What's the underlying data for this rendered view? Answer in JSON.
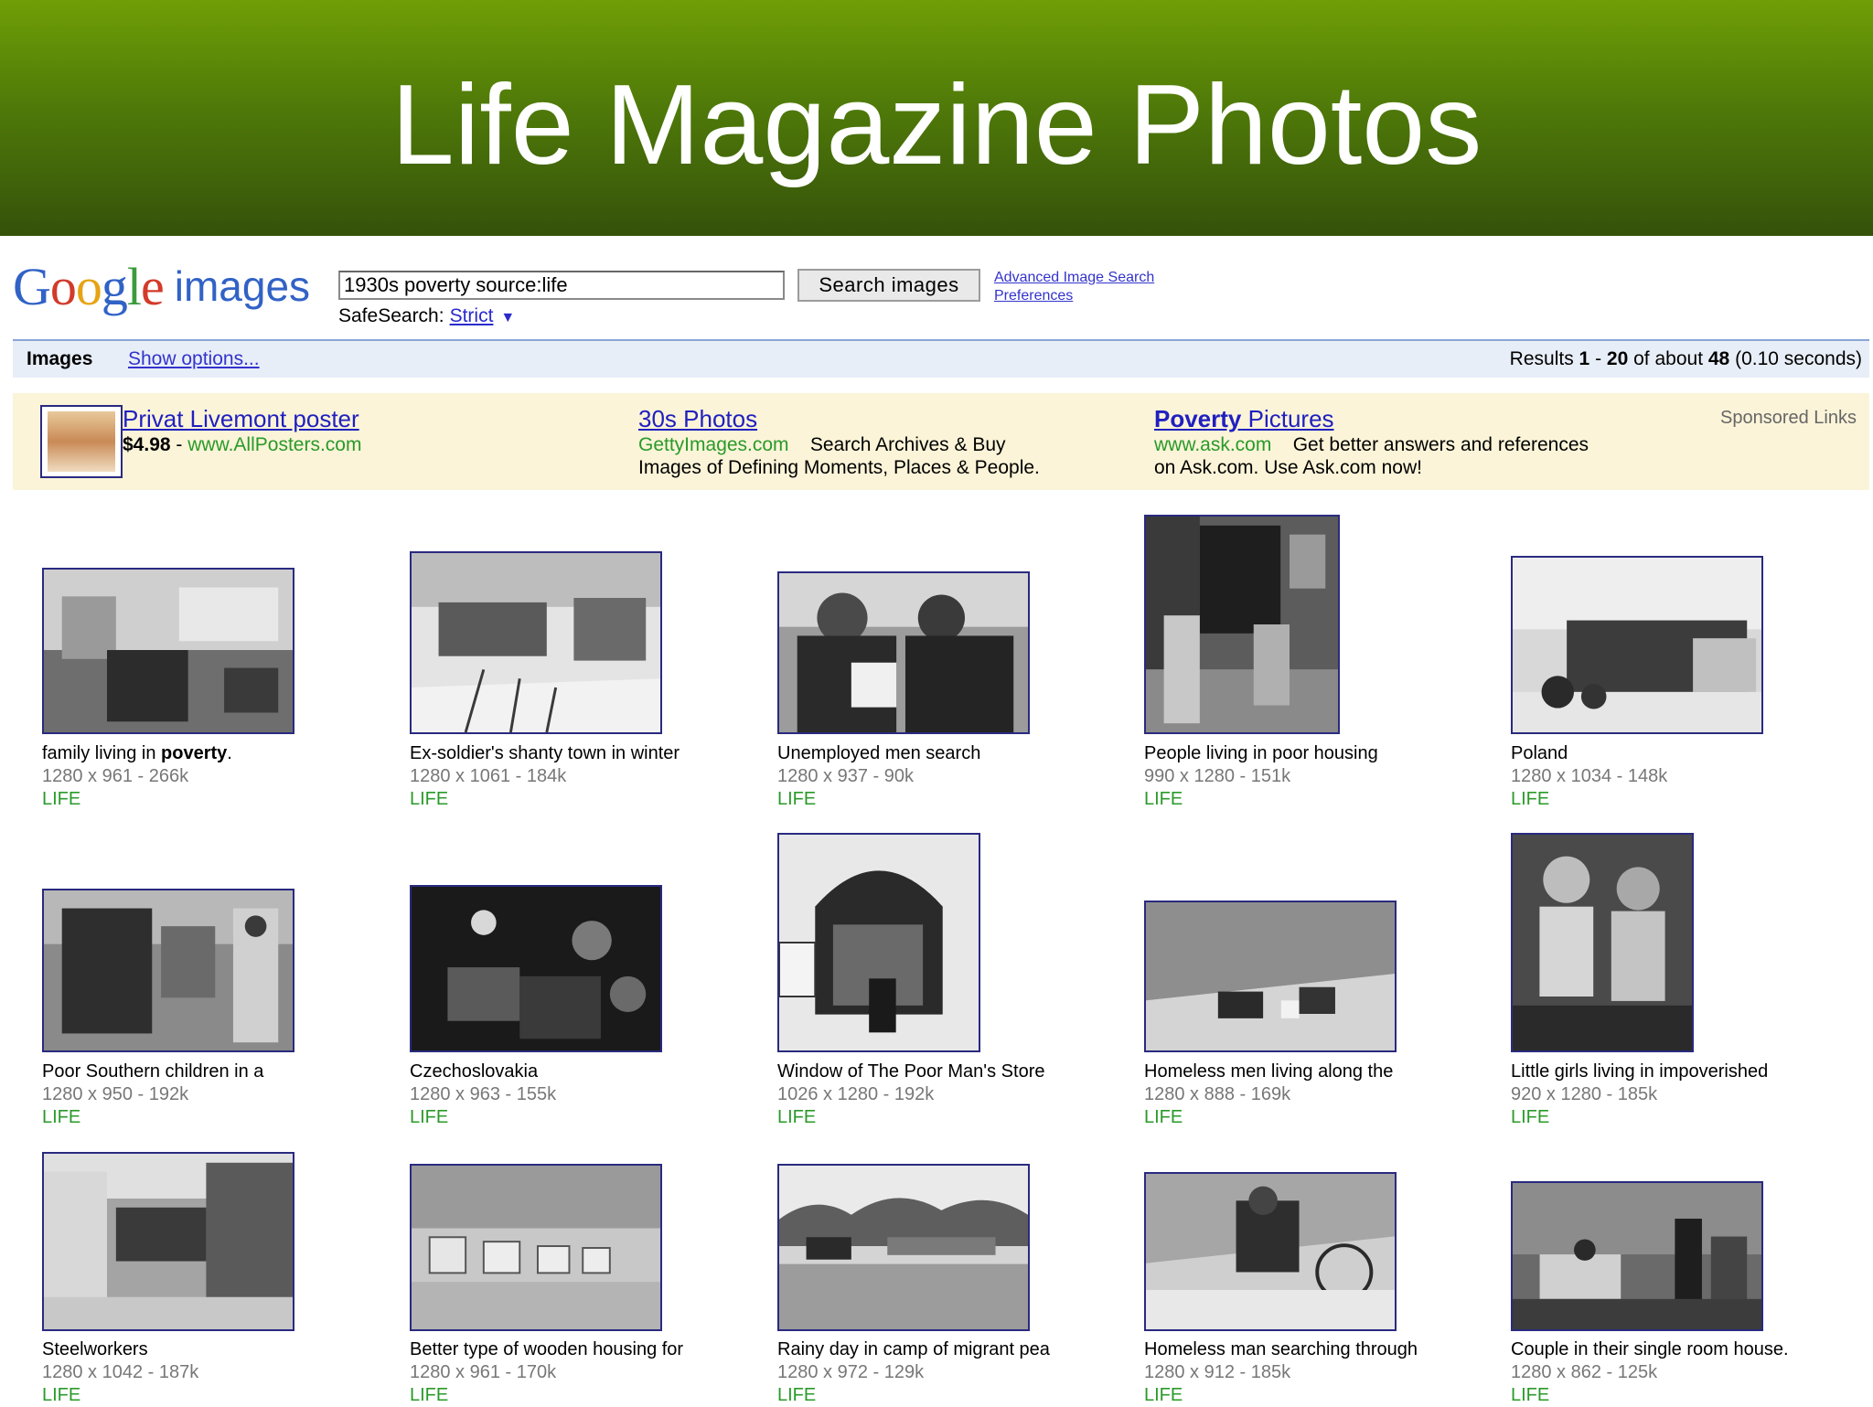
{
  "slide": {
    "title": "Life Magazine Photos"
  },
  "logo": {
    "letters": [
      "G",
      "o",
      "o",
      "g",
      "l",
      "e"
    ],
    "suffix": "images"
  },
  "search": {
    "query": "1930s poverty source:life",
    "button": "Search images",
    "advanced": "Advanced Image Search",
    "preferences": "Preferences",
    "safesearch_label": "SafeSearch:",
    "safesearch_value": "Strict",
    "safesearch_caret": "▼"
  },
  "results_bar": {
    "label": "Images",
    "options": "Show options...",
    "results_prefix": "Results",
    "range_start": "1",
    "range_sep": "-",
    "range_end": "20",
    "of_about": "of about",
    "total": "48",
    "time": "(0.10 seconds)"
  },
  "ads": {
    "sponsored": "Sponsored Links",
    "items": [
      {
        "title": "Privat Livemont poster",
        "price": "$4.98",
        "sep": "-",
        "url": "www.AllPosters.com"
      },
      {
        "title": "30s Photos",
        "url": "GettyImages.com",
        "line1": "Search Archives & Buy",
        "line2": "Images of Defining Moments, Places & People."
      },
      {
        "title_bold": "Poverty",
        "title_rest": " Pictures",
        "url": "www.ask.com",
        "line1": "Get better answers and references",
        "line2": "on Ask.com. Use Ask.com now!"
      }
    ]
  },
  "results": [
    {
      "title": "family living in ",
      "title_bold": "poverty",
      "title_end": ".",
      "dims": "1280 x 961 - 266k",
      "source": "LIFE",
      "icon": "photo-thumbnail"
    },
    {
      "title": "Ex-soldier's shanty town in winter",
      "dims": "1280 x 1061 - 184k",
      "source": "LIFE"
    },
    {
      "title": "Unemployed men search",
      "dims": "1280 x 937 - 90k",
      "source": "LIFE"
    },
    {
      "title": "People living in poor housing",
      "dims": "990 x 1280 - 151k",
      "source": "LIFE"
    },
    {
      "title": "Poland",
      "dims": "1280 x 1034 - 148k",
      "source": "LIFE"
    },
    {
      "title": "Poor Southern children in a",
      "dims": "1280 x 950 - 192k",
      "source": "LIFE"
    },
    {
      "title": "Czechoslovakia",
      "dims": "1280 x 963 - 155k",
      "source": "LIFE"
    },
    {
      "title": "Window of The Poor Man's Store",
      "dims": "1026 x 1280 - 192k",
      "source": "LIFE"
    },
    {
      "title": "Homeless men living along the",
      "dims": "1280 x 888 - 169k",
      "source": "LIFE"
    },
    {
      "title": "Little girls living in impoverished",
      "dims": "920 x 1280 - 185k",
      "source": "LIFE"
    },
    {
      "title": "Steelworkers",
      "dims": "1280 x 1042 - 187k",
      "source": "LIFE"
    },
    {
      "title": "Better type of wooden housing for",
      "dims": "1280 x 961 - 170k",
      "source": "LIFE"
    },
    {
      "title": "Rainy day in camp of migrant pea",
      "dims": "1280 x 972 - 129k",
      "source": "LIFE"
    },
    {
      "title": "Homeless man searching through",
      "dims": "1280 x 912 - 185k",
      "source": "LIFE"
    },
    {
      "title": "Couple in their single room house.",
      "dims": "1280 x 862 - 125k",
      "source": "LIFE"
    }
  ]
}
